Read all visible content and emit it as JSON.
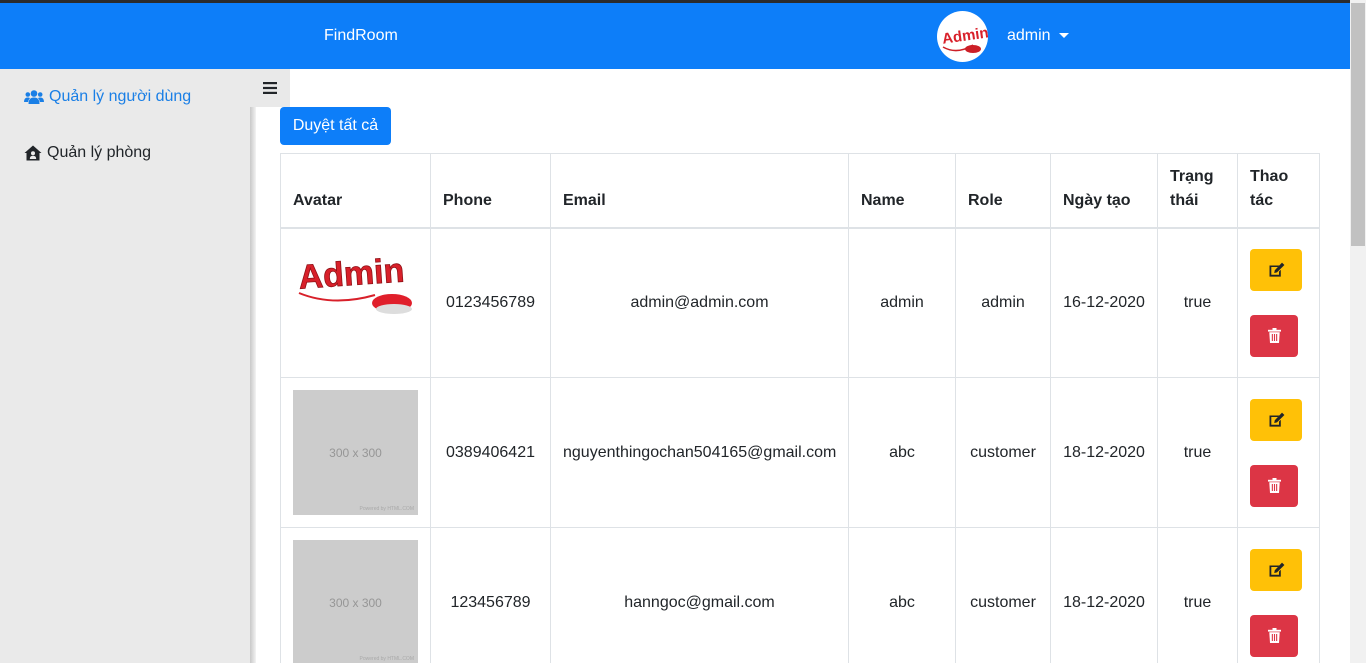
{
  "navbar": {
    "brand": "FindRoom",
    "avatar_text": "Admin",
    "user_name": "admin"
  },
  "sidebar": {
    "items": [
      {
        "label": "Quản lý người dùng",
        "icon": "users-icon",
        "active": true
      },
      {
        "label": "Quản lý phòng",
        "icon": "house-user-icon",
        "active": false
      }
    ]
  },
  "toolbar": {
    "approve_all_label": "Duyệt tất cả"
  },
  "table": {
    "headers": [
      "Avatar",
      "Phone",
      "Email",
      "Name",
      "Role",
      "Ngày tạo",
      "Trạng thái",
      "Thao tác"
    ],
    "rows": [
      {
        "avatar": "Admin",
        "phone": "0123456789",
        "email": "admin@admin.com",
        "name": "admin",
        "role": "admin",
        "created": "16-12-2020",
        "status": "true"
      },
      {
        "avatar": "300 x 300",
        "avatar_credit": "Powered by HTML.COM",
        "phone": "0389406421",
        "email": "nguyenthingochan504165@gmail.com",
        "name": "abc",
        "role": "customer",
        "created": "18-12-2020",
        "status": "true"
      },
      {
        "avatar": "300 x 300",
        "avatar_credit": "Powered by HTML.COM",
        "phone": "123456789",
        "email": "hanngoc@gmail.com",
        "name": "abc",
        "role": "customer",
        "created": "18-12-2020",
        "status": "true"
      }
    ]
  },
  "colors": {
    "primary": "#0d7ef9",
    "sidebar_bg": "#eaeaea",
    "active_link": "#1a7fe6",
    "warning": "#ffc107",
    "danger": "#dc3545"
  }
}
